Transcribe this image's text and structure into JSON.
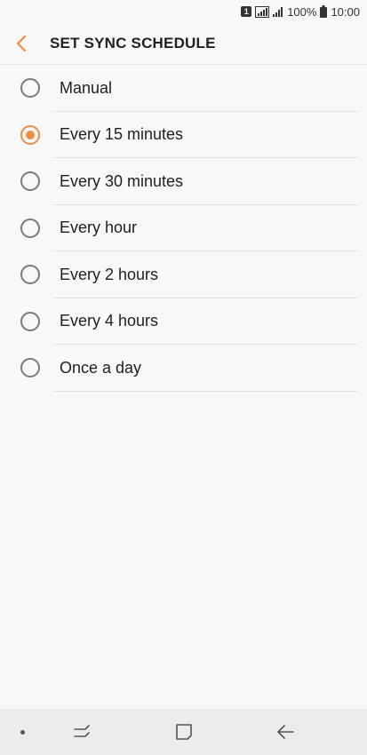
{
  "status_bar": {
    "sim_label": "1",
    "battery": "100%",
    "time": "10:00"
  },
  "header": {
    "title": "SET SYNC SCHEDULE",
    "back_icon": "chevron-left-icon"
  },
  "colors": {
    "accent": "#f08b42",
    "background": "#f8f8f8",
    "nav_bar": "#ececec"
  },
  "options": [
    {
      "label": "Manual",
      "selected": false
    },
    {
      "label": "Every 15 minutes",
      "selected": true
    },
    {
      "label": "Every 30 minutes",
      "selected": false
    },
    {
      "label": "Every hour",
      "selected": false
    },
    {
      "label": "Every 2 hours",
      "selected": false
    },
    {
      "label": "Every 4 hours",
      "selected": false
    },
    {
      "label": "Once a day",
      "selected": false
    }
  ],
  "nav_bar": {
    "icons": [
      "recent-apps-icon",
      "home-icon",
      "back-icon"
    ]
  }
}
